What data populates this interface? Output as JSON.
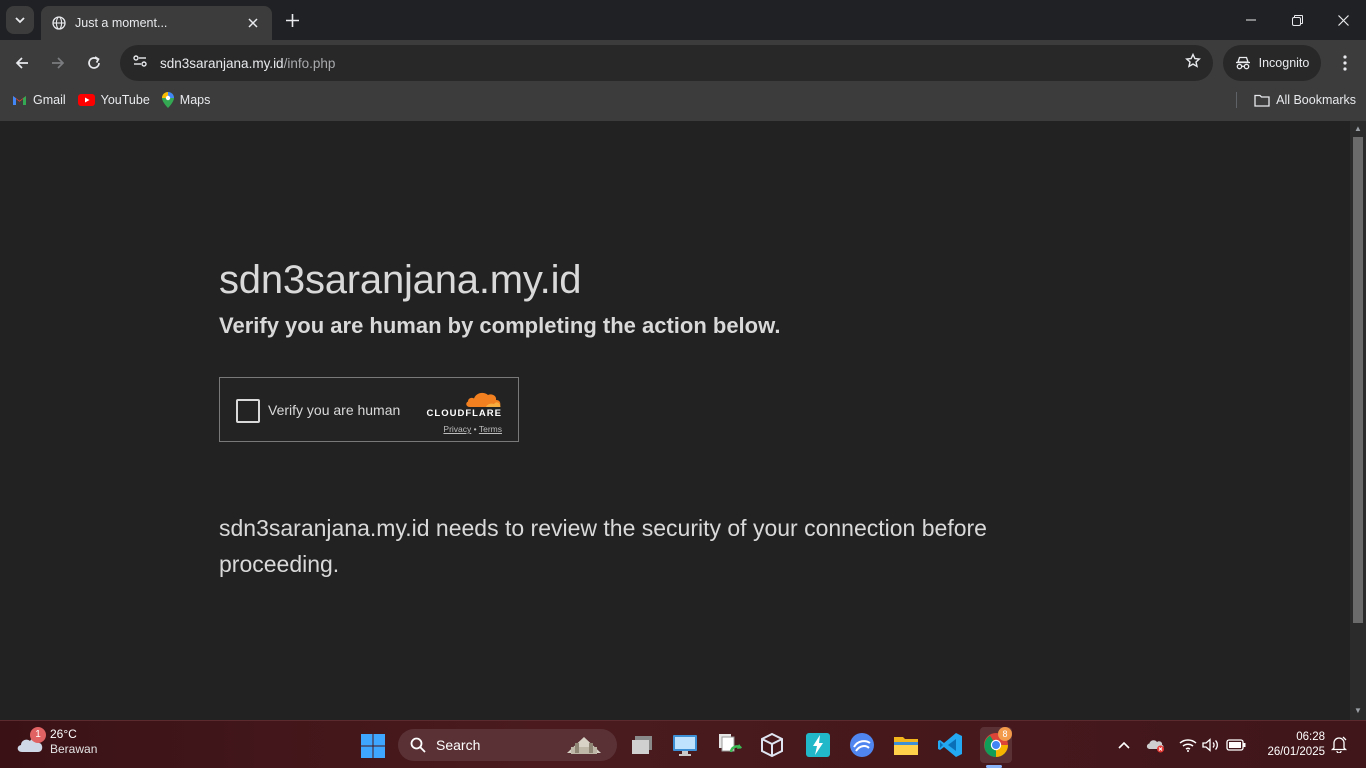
{
  "browser": {
    "tab_title": "Just a moment...",
    "url_host": "sdn3saranjana.my.id",
    "url_path": "/info.php",
    "incognito_label": "Incognito",
    "bookmarks": [
      {
        "label": "Gmail"
      },
      {
        "label": "YouTube"
      },
      {
        "label": "Maps"
      }
    ],
    "all_bookmarks_label": "All Bookmarks"
  },
  "page": {
    "site_title": "sdn3saranjana.my.id",
    "headline": "Verify you are human by completing the action below.",
    "widget": {
      "checkbox_label": "Verify you are human",
      "brand": "CLOUDFLARE",
      "privacy": "Privacy",
      "separator": "•",
      "terms": "Terms"
    },
    "message": "sdn3saranjana.my.id needs to review the security of your connection before proceeding."
  },
  "taskbar": {
    "weather_temp": "26°C",
    "weather_condition": "Berawan",
    "weather_badge": "1",
    "search_label": "Search",
    "chrome_badge": "8",
    "time": "06:28",
    "date": "26/01/2025"
  },
  "colors": {
    "cloudflare_orange": "#f38020",
    "page_bg": "#222222",
    "text": "#d9d9d9"
  }
}
